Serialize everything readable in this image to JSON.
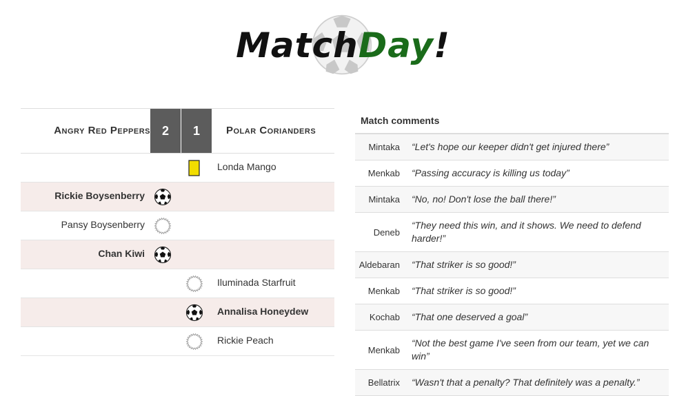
{
  "logo": {
    "part1": "Match",
    "part2": "Day",
    "part3": "!"
  },
  "scoreboard": {
    "home_team": "Angry Red Peppers",
    "away_team": "Polar Corianders",
    "home_score": "2",
    "away_score": "1"
  },
  "events": [
    {
      "home_player": "",
      "away_player": "Londa Mango",
      "side": "away",
      "icon": "yellow-card-icon",
      "bold": false,
      "highlight": false
    },
    {
      "home_player": "Rickie Boysenberry",
      "away_player": "",
      "side": "home",
      "icon": "goal-ball-icon",
      "bold": true,
      "highlight": true
    },
    {
      "home_player": "Pansy Boysenberry",
      "away_player": "",
      "side": "home",
      "icon": "missed-shot-icon",
      "bold": false,
      "highlight": false
    },
    {
      "home_player": "Chan Kiwi",
      "away_player": "",
      "side": "home",
      "icon": "goal-ball-icon",
      "bold": true,
      "highlight": true
    },
    {
      "home_player": "",
      "away_player": "Iluminada Starfruit",
      "side": "away",
      "icon": "missed-shot-icon",
      "bold": false,
      "highlight": false
    },
    {
      "home_player": "",
      "away_player": "Annalisa Honeydew",
      "side": "away",
      "icon": "goal-ball-icon",
      "bold": true,
      "highlight": true
    },
    {
      "home_player": "",
      "away_player": "Rickie Peach",
      "side": "away",
      "icon": "missed-shot-icon",
      "bold": false,
      "highlight": false
    }
  ],
  "comments": {
    "title": "Match comments",
    "items": [
      {
        "author": "Mintaka",
        "text": "“Let's hope our keeper didn't get injured there”"
      },
      {
        "author": "Menkab",
        "text": "“Passing accuracy is killing us today”"
      },
      {
        "author": "Mintaka",
        "text": "“No, no! Don't lose the ball there!”"
      },
      {
        "author": "Deneb",
        "text": "“They need this win, and it shows. We need to defend harder!”"
      },
      {
        "author": "Aldebaran",
        "text": "“That striker is so good!”"
      },
      {
        "author": "Menkab",
        "text": "“That striker is so good!”"
      },
      {
        "author": "Kochab",
        "text": "“That one deserved a goal”"
      },
      {
        "author": "Menkab",
        "text": "“Not the best game I've seen from our team, yet we can win”"
      },
      {
        "author": "Bellatrix",
        "text": "“Wasn't that a penalty? That definitely was a penalty.”"
      }
    ]
  },
  "colors": {
    "score_bg": "#5c5c5c",
    "highlight_row": "#f6ecea",
    "logo_green": "#1a6b1a",
    "yellow_card": "#f2dd00"
  }
}
